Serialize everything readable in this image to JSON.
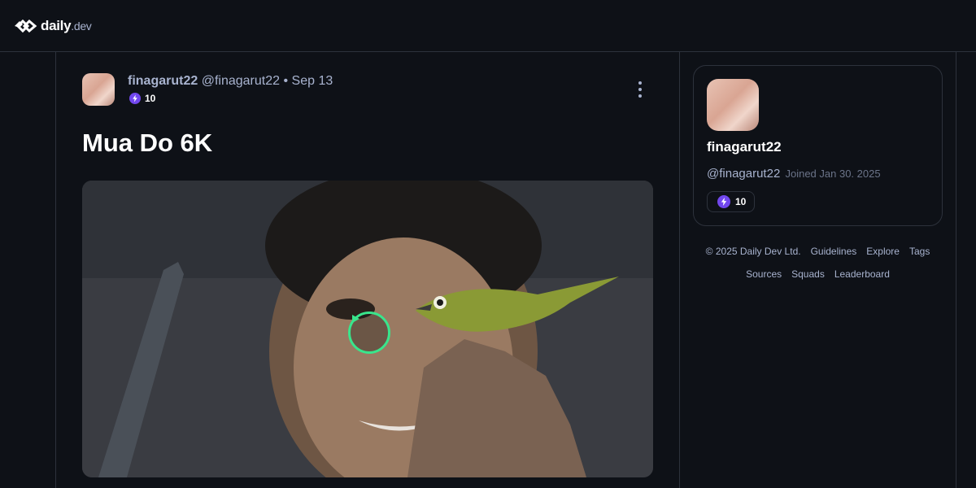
{
  "header": {
    "logo_text": "daily",
    "logo_suffix": ".dev",
    "logo_icon": "daily-dev-logo-icon"
  },
  "post": {
    "author_name": "finagarut22",
    "author_handle": "@finagarut22",
    "separator": "•",
    "date": "Sep 13",
    "reputation": "10",
    "title": "Mua Do 6K",
    "media_icon": "play-icon",
    "more_icon": "more-vertical-icon"
  },
  "profile": {
    "name": "finagarut22",
    "handle": "@finagarut22",
    "joined": "Joined Jan 30. 2025",
    "reputation": "10"
  },
  "footer": {
    "copyright": "© 2025 Daily Dev Ltd.",
    "links": [
      "Guidelines",
      "Explore",
      "Tags",
      "Sources",
      "Squads",
      "Leaderboard"
    ]
  },
  "colors": {
    "background": "#0e1117",
    "border": "#2d323c",
    "muted_text": "#a8b3cf",
    "reputation_accent": "#7147ed",
    "play_ring": "#39e58c"
  }
}
